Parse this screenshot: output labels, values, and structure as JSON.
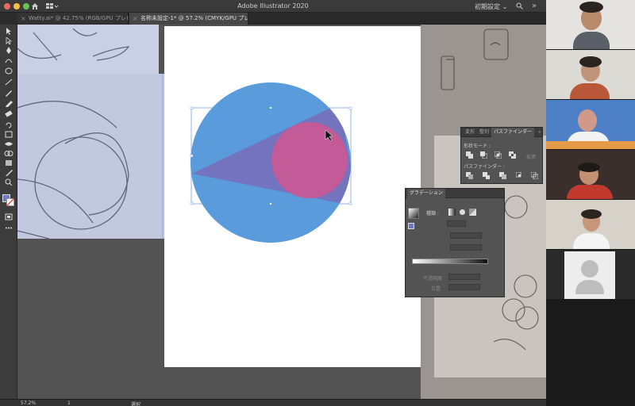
{
  "window": {
    "app_title": "Adobe Illustrator 2020",
    "workspace_label": "初期設定",
    "workspace_chevron": "⌄",
    "more_label": "»"
  },
  "tabs": [
    {
      "label": "Watty.ai* @ 42.75% (RGB/GPU プレビュー)",
      "close": "×",
      "active": false
    },
    {
      "label": "名称未設定-1* @ 57.2% (CMYK/GPU プレビュー)",
      "close": "×",
      "active": true
    }
  ],
  "toolbar": {
    "tools": [
      "selection-icon",
      "direct-selection-icon",
      "pen-icon",
      "curvature-icon",
      "ellipse-icon",
      "line-icon",
      "paintbrush-icon",
      "pencil-icon",
      "eraser-icon",
      "rotate-icon",
      "scale-icon",
      "width-icon",
      "shape-builder-icon",
      "gradient-icon",
      "eyedropper-icon",
      "blend-icon",
      "symbol-sprayer-icon",
      "artboard-icon",
      "hand-icon",
      "zoom-icon"
    ],
    "fill_color": "#6f78c2",
    "stroke_color": "#ffffff"
  },
  "artwork": {
    "circle_color": "#5a9bdc",
    "triangle_color": "#7373be",
    "small_circle_color": "#c25b97",
    "selection_color": "#7a9de0"
  },
  "pathfinder_panel": {
    "tabs": [
      "変形",
      "整列",
      "パスファインダー"
    ],
    "more": "»",
    "shape_modes_label": "形状モード :",
    "expand_label": "拡張",
    "pathfinders_label": "パスファインダー :"
  },
  "gradient_panel": {
    "title": "グラデーション",
    "type_label": "種類 :",
    "opacity_label": "不透明度",
    "location_label": "位置"
  },
  "statusbar": {
    "zoom": "57.2%",
    "page": "1",
    "tool": "選択"
  },
  "video_call": {
    "participants": [
      "participant-1",
      "participant-2",
      "participant-3",
      "participant-4",
      "participant-5",
      "participant-6"
    ]
  }
}
